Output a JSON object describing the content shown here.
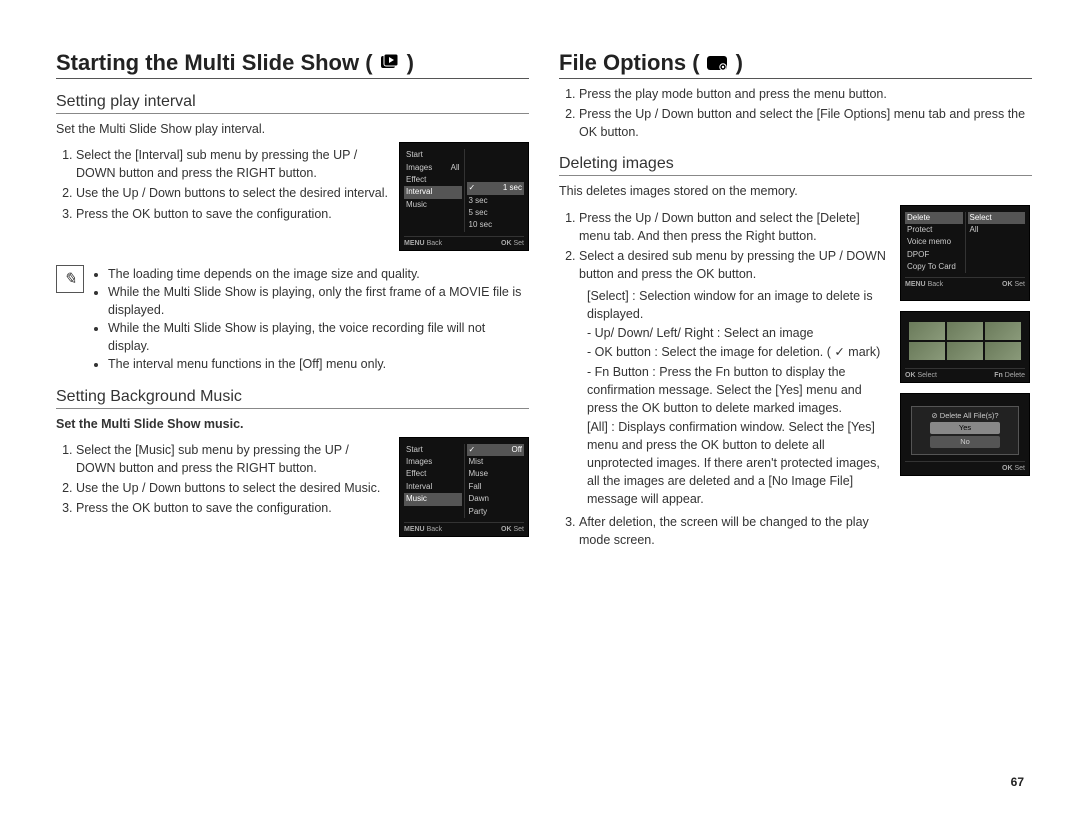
{
  "page_number": "67",
  "left": {
    "heading": "Starting the Multi Slide Show (",
    "heading_end": ")",
    "section1_title": "Setting play interval",
    "section1_intro": "Set the Multi Slide Show play interval.",
    "section1_steps": [
      "Select the [Interval] sub menu by pressing the UP / DOWN button and press the RIGHT button.",
      "Use the Up / Down buttons to select the desired interval.",
      "Press the OK button to save the configuration."
    ],
    "screen1": {
      "left": [
        "Start",
        "Images",
        "Effect",
        "Interval",
        "Music"
      ],
      "right_label": "All",
      "options": [
        "1 sec",
        "3 sec",
        "5 sec",
        "10 sec"
      ],
      "foot_back": "Back",
      "foot_set": "Set",
      "foot_back_key": "MENU",
      "foot_set_key": "OK"
    },
    "notes": [
      "The loading time depends on the image size and quality.",
      "While the Multi Slide Show is playing, only the first frame of a MOVIE file is displayed.",
      "While the Multi Slide Show is playing, the voice recording file will not display.",
      "The interval menu functions in the [Off] menu only."
    ],
    "section2_title": "Setting Background Music",
    "section2_intro": "Set the Multi Slide Show music.",
    "section2_steps": [
      "Select the [Music] sub menu by pressing the UP / DOWN button and press the RIGHT button.",
      "Use the Up / Down buttons to select the desired Music.",
      "Press the OK button to save the configuration."
    ],
    "screen2": {
      "left": [
        "Start",
        "Images",
        "Effect",
        "Interval",
        "Music"
      ],
      "options": [
        "Off",
        "Mist",
        "Muse",
        "Fall",
        "Dawn",
        "Party"
      ],
      "foot_back": "Back",
      "foot_set": "Set",
      "foot_back_key": "MENU",
      "foot_set_key": "OK"
    }
  },
  "right": {
    "heading": "File Options (",
    "heading_end": ")",
    "top_steps": [
      "Press the play mode button and press the menu button.",
      "Press the Up / Down button and select the [File Options] menu tab and press the OK button."
    ],
    "section1_title": "Deleting images",
    "section1_intro": "This deletes images stored on the memory.",
    "step1": "Press the Up / Down button and select the [Delete] menu tab. And then press the Right button.",
    "step2": "Select a desired sub menu by pressing the UP / DOWN button and press the OK button.",
    "select_line": "[Select] : Selection window for an image to delete is displayed.",
    "select_sub": [
      "- Up/ Down/ Left/ Right : Select an image",
      "- OK button : Select the image for deletion. ( ✓ mark)",
      "- Fn Button : Press the Fn button to display the confirmation message. Select the [Yes] menu and press the OK button to delete marked images."
    ],
    "all_line": "[All] : Displays confirmation window. Select the [Yes] menu and press the OK button to delete all unprotected images. If there aren't protected images, all the images are deleted and a [No Image File] message will appear.",
    "step3": "After deletion, the screen will be changed to the play mode screen.",
    "screenA": {
      "left": [
        "Delete",
        "Protect",
        "Voice memo",
        "DPOF",
        "Copy To Card"
      ],
      "right": [
        "Select",
        "All"
      ],
      "foot_back": "Back",
      "foot_set": "Set",
      "foot_back_key": "MENU",
      "foot_set_key": "OK"
    },
    "screenB": {
      "foot_select": "Select",
      "foot_delete": "Delete",
      "foot_select_key": "OK",
      "foot_delete_key": "Fn"
    },
    "screenC": {
      "title": "Delete All File(s)?",
      "yes": "Yes",
      "no": "No",
      "foot_set": "Set",
      "foot_set_key": "OK"
    }
  }
}
